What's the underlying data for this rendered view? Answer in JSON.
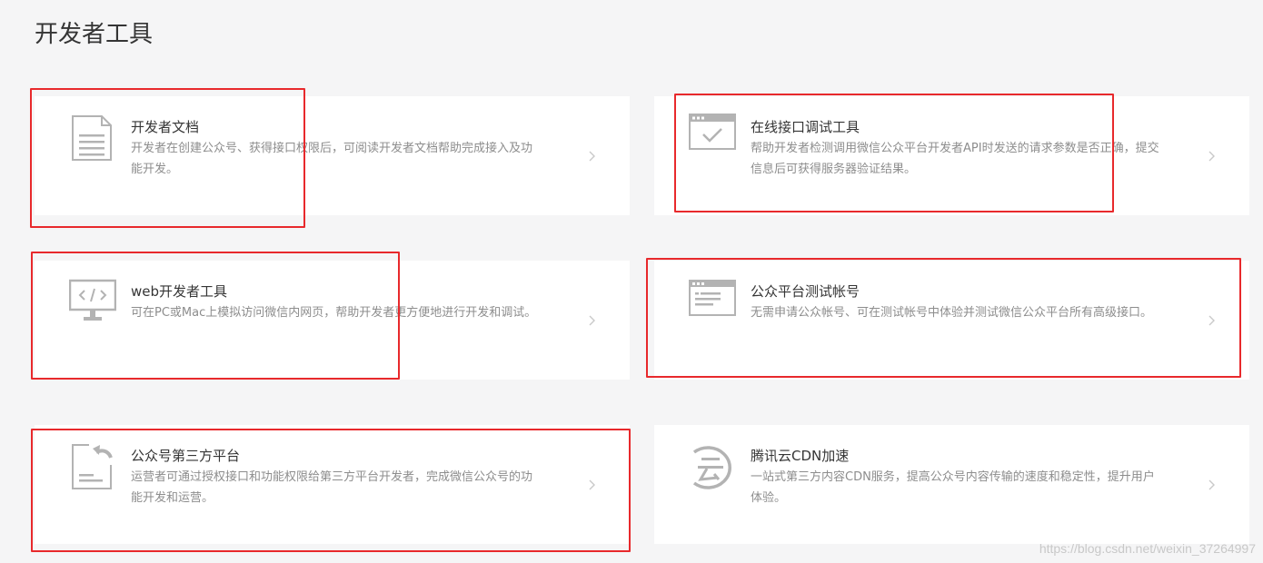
{
  "page": {
    "title": "开发者工具"
  },
  "cards": [
    {
      "title": "开发者文档",
      "desc_line1": "开发者在创建公众号、获得接口权限后，可阅读开发者文档帮助完成接入及功",
      "desc_line2": "能开发。",
      "icon": "document-icon"
    },
    {
      "title": "在线接口调试工具",
      "desc_line1": "帮助开发者检测调用微信公众平台开发者API时发送的请求参数是否正确，提交",
      "desc_line2": "信息后可获得服务器验证结果。",
      "icon": "browser-check-icon"
    },
    {
      "title": "web开发者工具",
      "desc_line1": "可在PC或Mac上模拟访问微信内网页，帮助开发者更方便地进行开发和调试。",
      "desc_line2": "",
      "icon": "monitor-code-icon"
    },
    {
      "title": "公众平台测试帐号",
      "desc_line1": "无需申请公众帐号、可在测试帐号中体验并测试微信公众平台所有高级接口。",
      "desc_line2": "",
      "icon": "browser-list-icon"
    },
    {
      "title": "公众号第三方平台",
      "desc_line1": "运营者可通过授权接口和功能权限给第三方平台开发者，完成微信公众号的功",
      "desc_line2": "能开发和运营。",
      "icon": "document-share-icon"
    },
    {
      "title": "腾讯云CDN加速",
      "desc_line1": "一站式第三方内容CDN服务，提高公众号内容传输的速度和稳定性，提升用户",
      "desc_line2": "体验。",
      "icon": "cloud-text-icon"
    }
  ],
  "watermark": "https://blog.csdn.net/weixin_37264997",
  "colors": {
    "highlight": "#e8292c",
    "icon": "#b3b3b3",
    "background": "#f5f5f6"
  }
}
